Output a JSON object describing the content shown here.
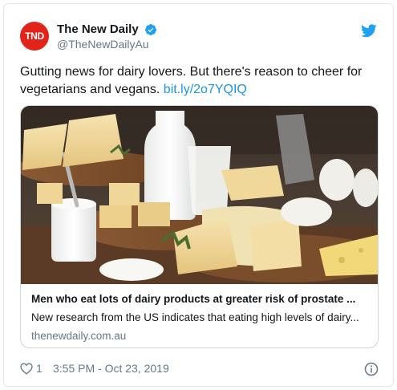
{
  "author": {
    "avatar_text": "TND",
    "display_name": "The New Daily",
    "handle": "@TheNewDailyAu",
    "verified_icon": "verified-badge-icon"
  },
  "tweet": {
    "text": "Gutting news for dairy lovers. But there's reason to cheer for vegetarians and vegans. ",
    "link": "bit.ly/2o7YQIQ"
  },
  "card": {
    "title": "Men who eat lots of dairy products at greater risk of prostate ...",
    "description": "New research from the US indicates that eating high levels of dairy...",
    "domain": "thenewdaily.com.au"
  },
  "footer": {
    "like_count": "1",
    "timestamp": "3:55 PM - Oct 23, 2019"
  },
  "colors": {
    "avatar": "#e2231a",
    "verified": "#1da1f2",
    "link": "#1b95e0",
    "muted": "#657786"
  }
}
